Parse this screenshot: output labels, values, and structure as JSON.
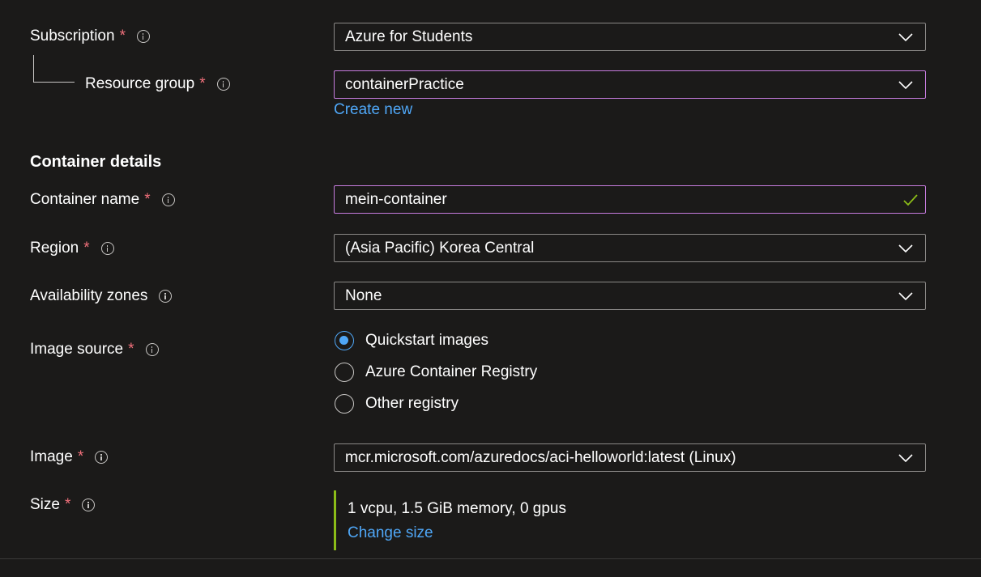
{
  "subscription": {
    "label": "Subscription",
    "value": "Azure for Students"
  },
  "resource_group": {
    "label": "Resource group",
    "value": "containerPractice",
    "create_new": "Create new"
  },
  "container_details": {
    "title": "Container details"
  },
  "container_name": {
    "label": "Container name",
    "value": "mein-container"
  },
  "region": {
    "label": "Region",
    "value": "(Asia Pacific) Korea Central"
  },
  "availability_zones": {
    "label": "Availability zones",
    "value": "None"
  },
  "image_source": {
    "label": "Image source",
    "options": [
      "Quickstart images",
      "Azure Container Registry",
      "Other registry"
    ],
    "selected": "Quickstart images"
  },
  "image": {
    "label": "Image",
    "value": "mcr.microsoft.com/azuredocs/aci-helloworld:latest (Linux)"
  },
  "size": {
    "label": "Size",
    "value": "1 vcpu, 1.5 GiB memory, 0 gpus",
    "change": "Change size"
  },
  "required_marker": "*",
  "colors": {
    "background": "#1b1a19",
    "link": "#4fa7f7",
    "required": "#f1707b",
    "focus_border": "#c67cde",
    "valid": "#8cbd18"
  },
  "icons": [
    "info-icon",
    "chevron-down-icon",
    "checkmark-icon"
  ]
}
